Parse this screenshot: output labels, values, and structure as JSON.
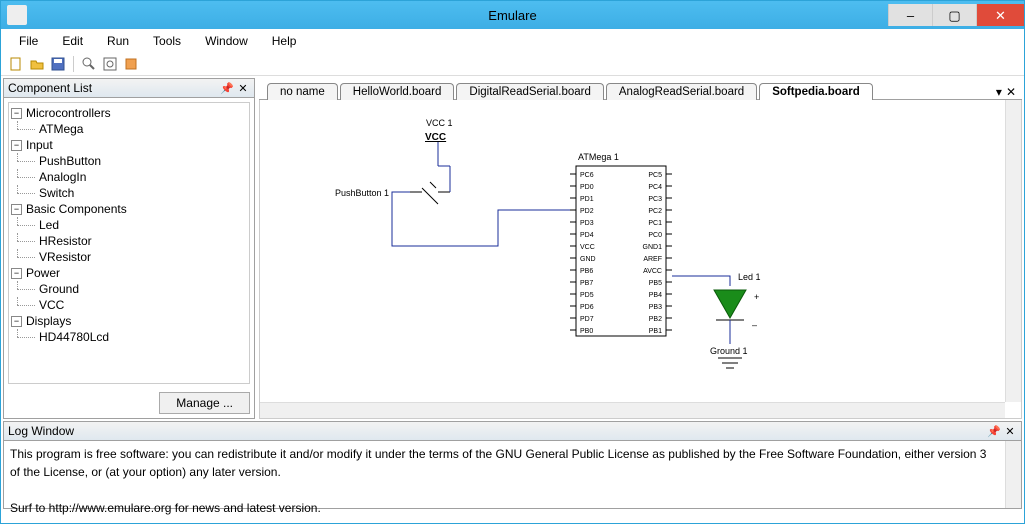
{
  "window": {
    "title": "Emulare"
  },
  "menu": [
    "File",
    "Edit",
    "Run",
    "Tools",
    "Window",
    "Help"
  ],
  "toolbar": [
    "new",
    "open",
    "save",
    "sep",
    "find",
    "zoom-fit",
    "run"
  ],
  "component_panel": {
    "title": "Component List",
    "manage_label": "Manage ...",
    "categories": [
      {
        "name": "Microcontrollers",
        "items": [
          "ATMega"
        ]
      },
      {
        "name": "Input",
        "items": [
          "PushButton",
          "AnalogIn",
          "Switch"
        ]
      },
      {
        "name": "Basic Components",
        "items": [
          "Led",
          "HResistor",
          "VResistor"
        ]
      },
      {
        "name": "Power",
        "items": [
          "Ground",
          "VCC"
        ]
      },
      {
        "name": "Displays",
        "items": [
          "HD44780Lcd"
        ]
      }
    ]
  },
  "tabs": {
    "items": [
      "no name",
      "HelloWorld.board",
      "DigitalReadSerial.board",
      "AnalogReadSerial.board",
      "Softpedia.board"
    ],
    "active_index": 4
  },
  "schematic": {
    "vcc": {
      "label": "VCC 1",
      "text": "VCC"
    },
    "pushbutton": {
      "label": "PushButton 1"
    },
    "chip": {
      "label": "ATMega 1",
      "left_pins": [
        "PC6",
        "PD0",
        "PD1",
        "PD2",
        "PD3",
        "PD4",
        "VCC",
        "GND",
        "PB6",
        "PB7",
        "PD5",
        "PD6",
        "PD7",
        "PB0"
      ],
      "right_pins": [
        "PC5",
        "PC4",
        "PC3",
        "PC2",
        "PC1",
        "PC0",
        "GND1",
        "AREF",
        "AVCC",
        "PB5",
        "PB4",
        "PB3",
        "PB2",
        "PB1"
      ]
    },
    "led": {
      "label": "Led 1",
      "plus": "+",
      "minus": "–"
    },
    "ground": {
      "label": "Ground 1"
    }
  },
  "log": {
    "title": "Log Window",
    "lines": [
      "This program is free software: you can redistribute it and/or modify it under the terms of the GNU General Public License as published by the Free Software Foundation, either version 3 of the License, or (at your option) any later version.",
      "",
      "Surf to http://www.emulare.org for news and latest version."
    ]
  }
}
